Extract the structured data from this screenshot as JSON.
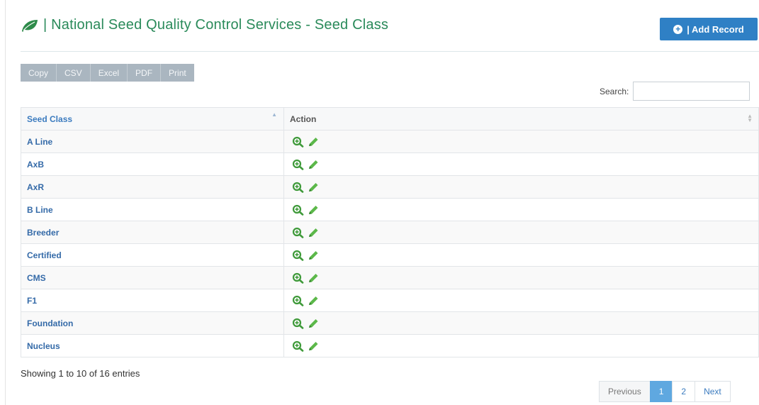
{
  "header": {
    "title": "| National Seed Quality Control Services - Seed Class",
    "add_record_label": "| Add Record",
    "add_record_icon": "plus-circle-icon"
  },
  "toolbar": {
    "buttons": [
      "Copy",
      "CSV",
      "Excel",
      "PDF",
      "Print"
    ]
  },
  "search": {
    "label": "Search:",
    "value": ""
  },
  "table": {
    "columns": [
      "Seed Class",
      "Action"
    ],
    "rows": [
      {
        "seed_class": "A Line"
      },
      {
        "seed_class": "AxB"
      },
      {
        "seed_class": "AxR"
      },
      {
        "seed_class": "B Line"
      },
      {
        "seed_class": "Breeder"
      },
      {
        "seed_class": "Certified"
      },
      {
        "seed_class": "CMS"
      },
      {
        "seed_class": "F1"
      },
      {
        "seed_class": "Foundation"
      },
      {
        "seed_class": "Nucleus"
      }
    ]
  },
  "footer": {
    "info": "Showing 1 to 10 of 16 entries"
  },
  "pagination": {
    "previous": "Previous",
    "pages": [
      "1",
      "2"
    ],
    "current_page": "1",
    "next": "Next"
  },
  "colors": {
    "accent": "#2f80c5",
    "title": "#2a8a5a",
    "action_icons": "#4caa3c"
  }
}
